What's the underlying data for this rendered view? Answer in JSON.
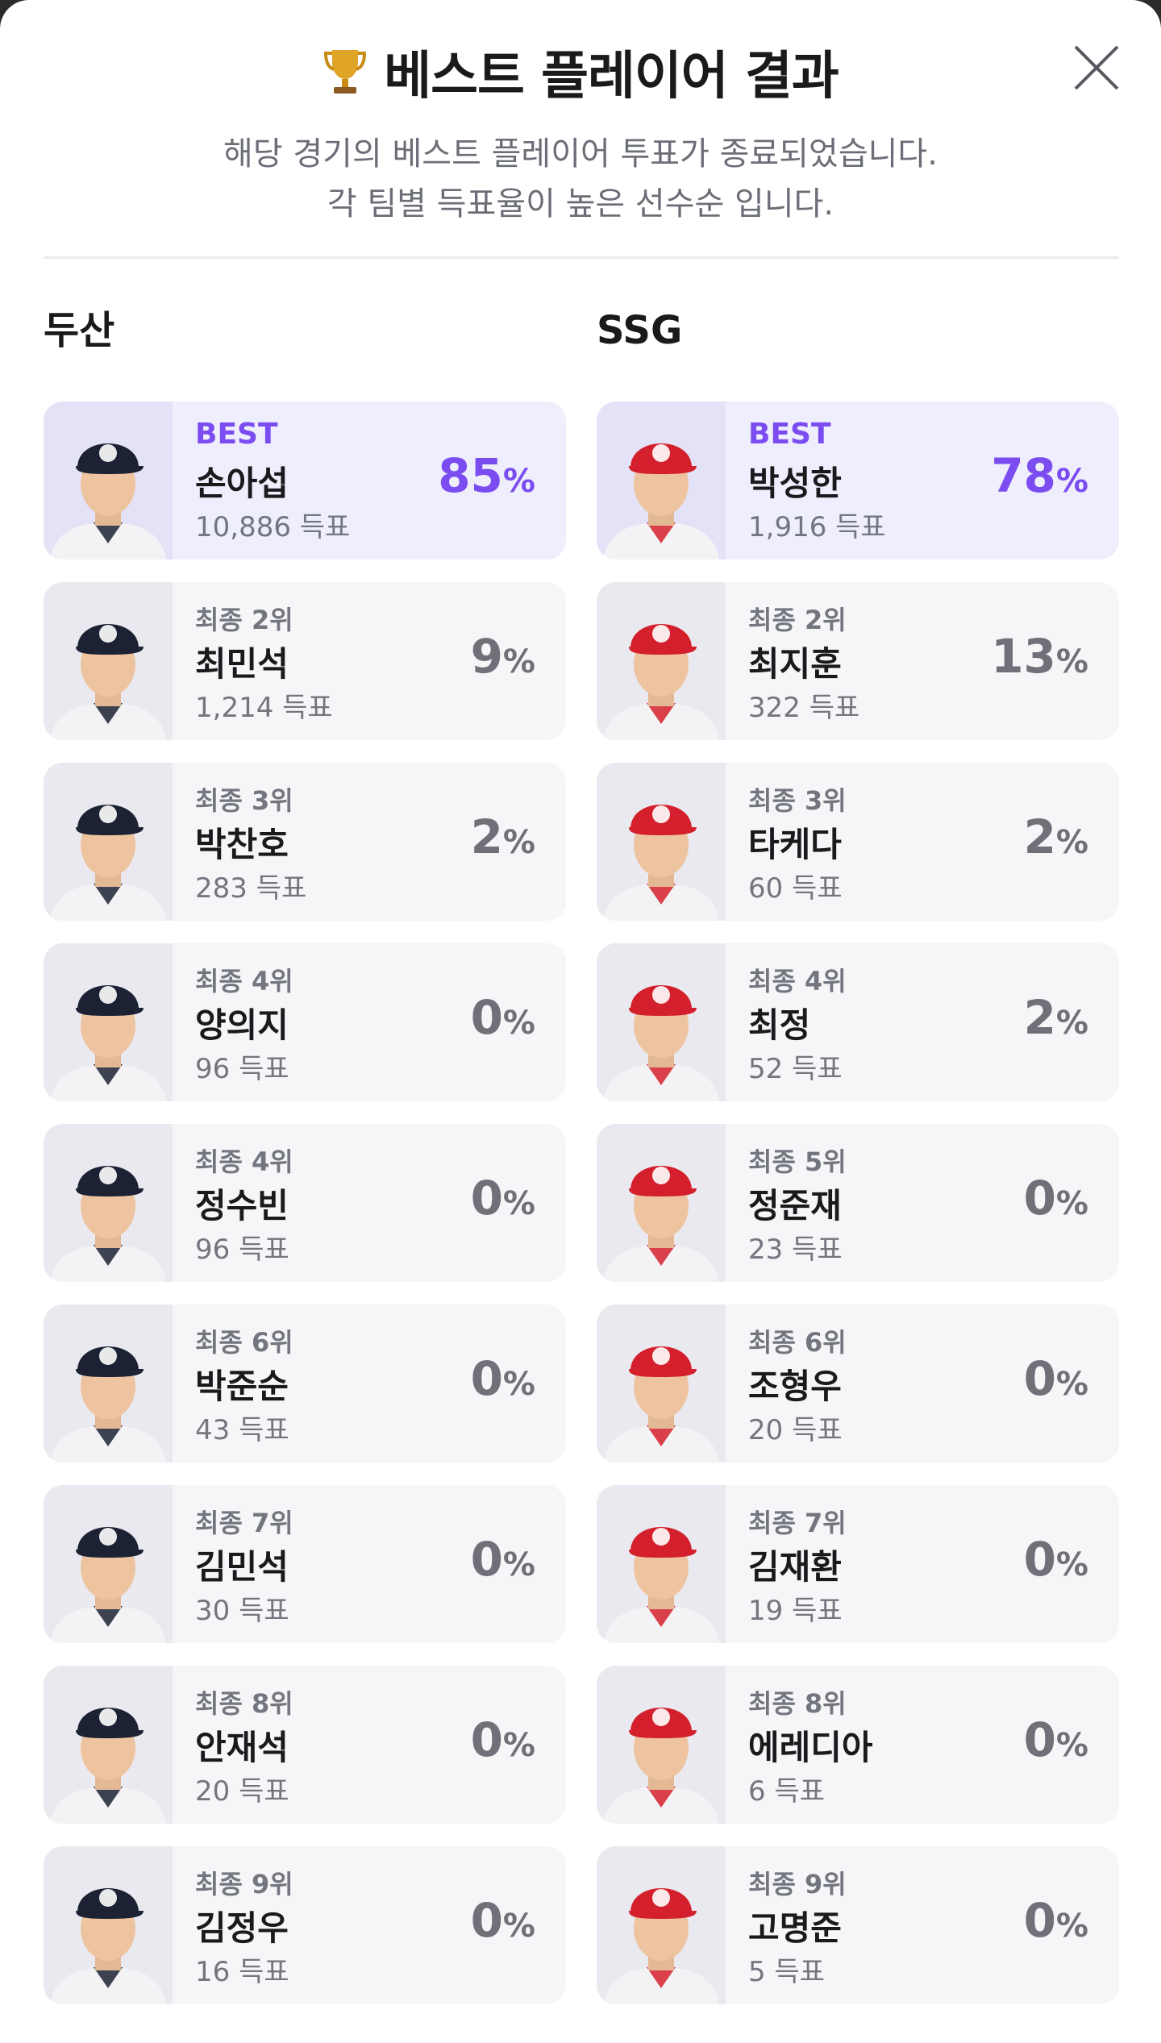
{
  "modal": {
    "title": "베스트 플레이어 결과",
    "subtitle_line1": "해당 경기의 베스트 플레이어 투표가 종료되었습니다.",
    "subtitle_line2": "각 팀별 득표율이 높은 선수순 입니다.",
    "trophy_icon": "trophy-icon",
    "close_icon": "close-icon"
  },
  "teams": [
    {
      "name": "두산",
      "cap_color": "#1c2233",
      "players": [
        {
          "rank": "BEST",
          "name": "손아섭",
          "votes": "10,886 득표",
          "pct": "85",
          "unit": "%"
        },
        {
          "rank": "최종 2위",
          "name": "최민석",
          "votes": "1,214 득표",
          "pct": "9",
          "unit": "%"
        },
        {
          "rank": "최종 3위",
          "name": "박찬호",
          "votes": "283 득표",
          "pct": "2",
          "unit": "%"
        },
        {
          "rank": "최종 4위",
          "name": "양의지",
          "votes": "96 득표",
          "pct": "0",
          "unit": "%"
        },
        {
          "rank": "최종 4위",
          "name": "정수빈",
          "votes": "96 득표",
          "pct": "0",
          "unit": "%"
        },
        {
          "rank": "최종 6위",
          "name": "박준순",
          "votes": "43 득표",
          "pct": "0",
          "unit": "%"
        },
        {
          "rank": "최종 7위",
          "name": "김민석",
          "votes": "30 득표",
          "pct": "0",
          "unit": "%"
        },
        {
          "rank": "최종 8위",
          "name": "안재석",
          "votes": "20 득표",
          "pct": "0",
          "unit": "%"
        },
        {
          "rank": "최종 9위",
          "name": "김정우",
          "votes": "16 득표",
          "pct": "0",
          "unit": "%"
        }
      ]
    },
    {
      "name": "SSG",
      "cap_color": "#d3202c",
      "players": [
        {
          "rank": "BEST",
          "name": "박성한",
          "votes": "1,916 득표",
          "pct": "78",
          "unit": "%"
        },
        {
          "rank": "최종 2위",
          "name": "최지훈",
          "votes": "322 득표",
          "pct": "13",
          "unit": "%"
        },
        {
          "rank": "최종 3위",
          "name": "타케다",
          "votes": "60 득표",
          "pct": "2",
          "unit": "%"
        },
        {
          "rank": "최종 4위",
          "name": "최정",
          "votes": "52 득표",
          "pct": "2",
          "unit": "%"
        },
        {
          "rank": "최종 5위",
          "name": "정준재",
          "votes": "23 득표",
          "pct": "0",
          "unit": "%"
        },
        {
          "rank": "최종 6위",
          "name": "조형우",
          "votes": "20 득표",
          "pct": "0",
          "unit": "%"
        },
        {
          "rank": "최종 7위",
          "name": "김재환",
          "votes": "19 득표",
          "pct": "0",
          "unit": "%"
        },
        {
          "rank": "최종 8위",
          "name": "에레디아",
          "votes": "6 득표",
          "pct": "0",
          "unit": "%"
        },
        {
          "rank": "최종 9위",
          "name": "고명준",
          "votes": "5 득표",
          "pct": "0",
          "unit": "%"
        }
      ]
    }
  ],
  "colors": {
    "accent": "#7b4cf0",
    "best_bg": "#efeefc",
    "card_bg": "#f6f6f9"
  }
}
